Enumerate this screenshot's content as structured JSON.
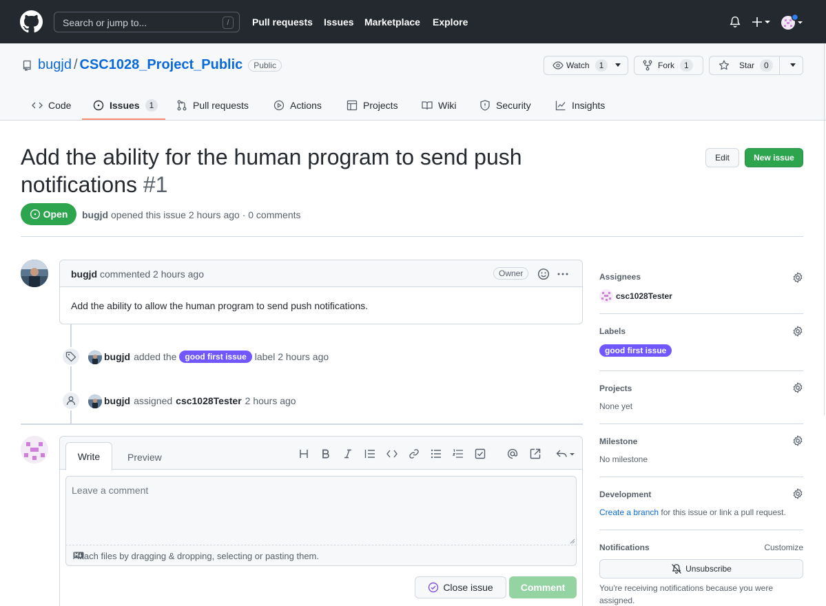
{
  "header": {
    "search_placeholder": "Search or jump to...",
    "search_shortcut": "/",
    "nav": [
      "Pull requests",
      "Issues",
      "Marketplace",
      "Explore"
    ]
  },
  "repo": {
    "owner": "bugjd",
    "separator": "/",
    "name": "CSC1028_Project_Public",
    "visibility": "Public",
    "watch_label": "Watch",
    "watch_count": "1",
    "fork_label": "Fork",
    "fork_count": "1",
    "star_label": "Star",
    "star_count": "0",
    "tabs": [
      {
        "label": "Code",
        "icon": "code-icon"
      },
      {
        "label": "Issues",
        "icon": "issue-icon",
        "count": "1",
        "selected": true
      },
      {
        "label": "Pull requests",
        "icon": "pull-request-icon"
      },
      {
        "label": "Actions",
        "icon": "play-icon"
      },
      {
        "label": "Projects",
        "icon": "table-icon"
      },
      {
        "label": "Wiki",
        "icon": "book-icon"
      },
      {
        "label": "Security",
        "icon": "shield-icon"
      },
      {
        "label": "Insights",
        "icon": "graph-icon"
      }
    ]
  },
  "issue": {
    "title": "Add the ability for the human program to send push notifications",
    "number": "#1",
    "edit_label": "Edit",
    "new_issue_label": "New issue",
    "state": "Open",
    "author": "bugjd",
    "meta": "opened this issue 2 hours ago · 0 comments"
  },
  "comment": {
    "author": "bugjd",
    "time": "commented 2 hours ago",
    "role": "Owner",
    "body": "Add the ability to allow the human program to send push notifications."
  },
  "timeline": [
    {
      "actor": "bugjd",
      "pre": "added the",
      "label": "good first issue",
      "post": "label 2 hours ago",
      "icon": "tag-icon"
    },
    {
      "actor": "bugjd",
      "pre": "assigned",
      "target": "csc1028Tester",
      "post": "2 hours ago",
      "icon": "person-icon"
    }
  ],
  "form": {
    "write_tab": "Write",
    "preview_tab": "Preview",
    "placeholder": "Leave a comment",
    "attach_text": "Attach files by dragging & dropping, selecting or pasting them.",
    "close_label": "Close issue",
    "comment_label": "Comment"
  },
  "sidebar": {
    "assignees_title": "Assignees",
    "assignee": "csc1028Tester",
    "labels_title": "Labels",
    "label": "good first issue",
    "projects_title": "Projects",
    "projects_value": "None yet",
    "milestone_title": "Milestone",
    "milestone_value": "No milestone",
    "development_title": "Development",
    "dev_link": "Create a branch",
    "dev_text": "for this issue or link a pull request.",
    "notifications_title": "Notifications",
    "customize": "Customize",
    "unsubscribe": "Unsubscribe",
    "notif_reason": "You're receiving notifications because you were assigned."
  },
  "colors": {
    "header_bg": "#24292f",
    "link": "#0969da",
    "open_green": "#2da44e",
    "label_purple": "#7057ff",
    "tab_underline": "#fd8c73"
  }
}
